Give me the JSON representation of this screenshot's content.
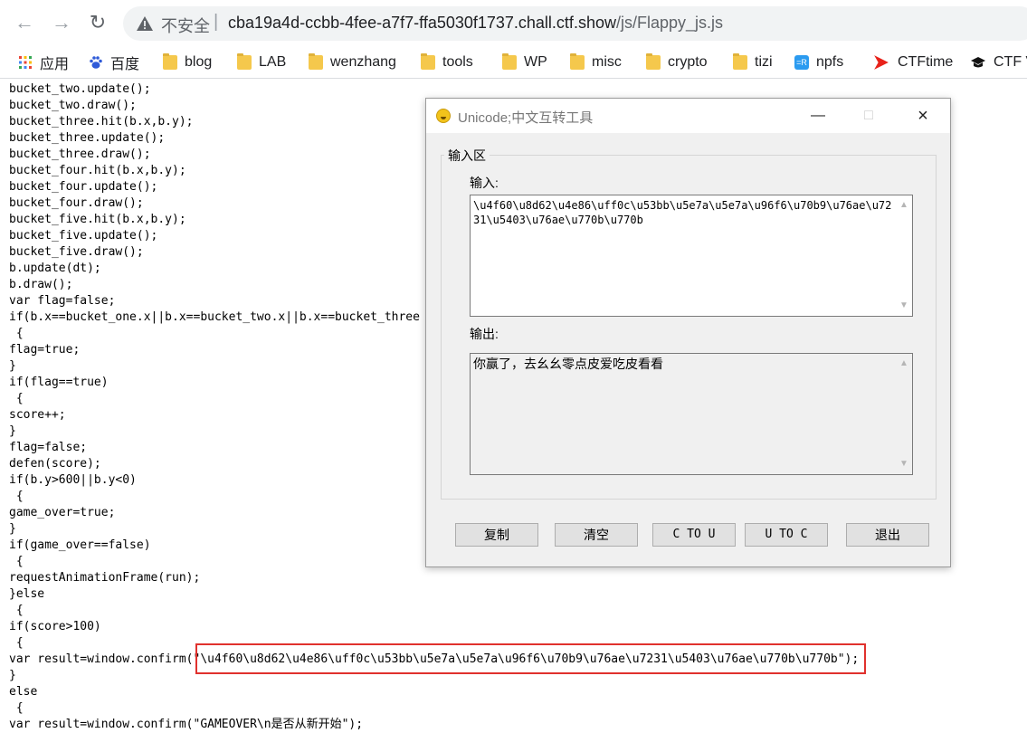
{
  "browser": {
    "url_warning": "不安全",
    "url_host": "cba19a4d-ccbb-4fee-a7f7-ffa5030f1737.chall.ctf.show",
    "url_path": "/js/Flappy_js.js",
    "icons": [
      "back-icon",
      "forward-icon",
      "reload-icon",
      "warning-icon"
    ]
  },
  "bookmarks": [
    {
      "label": "应用",
      "icon": "apps-grid-icon"
    },
    {
      "label": "百度",
      "icon": "baidu-paw-icon"
    },
    {
      "label": "blog",
      "icon": "folder-icon"
    },
    {
      "label": "LAB",
      "icon": "folder-icon"
    },
    {
      "label": "wenzhang",
      "icon": "folder-icon"
    },
    {
      "label": "tools",
      "icon": "folder-icon"
    },
    {
      "label": "WP",
      "icon": "folder-icon"
    },
    {
      "label": "misc",
      "icon": "folder-icon"
    },
    {
      "label": "crypto",
      "icon": "folder-icon"
    },
    {
      "label": "tizi",
      "icon": "folder-icon"
    },
    {
      "label": "npfs",
      "icon": "npfs-icon"
    },
    {
      "label": "CTFtime",
      "icon": "ctftime-icon"
    },
    {
      "label": "CTF V",
      "icon": "graduation-cap-icon"
    }
  ],
  "code_lines": [
    "bucket_two.update();",
    "bucket_two.draw();",
    "bucket_three.hit(b.x,b.y);",
    "bucket_three.update();",
    "bucket_three.draw();",
    "bucket_four.hit(b.x,b.y);",
    "bucket_four.update();",
    "bucket_four.draw();",
    "bucket_five.hit(b.x,b.y);",
    "bucket_five.update();",
    "bucket_five.draw();",
    "b.update(dt);",
    "b.draw();",
    "var flag=false;",
    "if(b.x==bucket_one.x||b.x==bucket_two.x||b.x==bucket_three",
    " {",
    "flag=true;",
    "}",
    "if(flag==true)",
    " {",
    "score++;",
    "}",
    "flag=false;",
    "defen(score);",
    "if(b.y>600||b.y<0)",
    " {",
    "game_over=true;",
    "}",
    "if(game_over==false)",
    " {",
    "requestAnimationFrame(run);",
    "}else",
    " {",
    "if(score>100)",
    " {",
    "var result=window.confirm(\"\\u4f60\\u8d62\\u4e86\\uff0c\\u53bb\\u5e7a\\u5e7a\\u96f6\\u70b9\\u76ae\\u7231\\u5403\\u76ae\\u770b\\u770b\");",
    "}",
    "else",
    " {",
    "var result=window.confirm(\"GAMEOVER\\n是否从新开始\");"
  ],
  "dialog": {
    "title": "Unicode;中文互转工具",
    "group_title": "输入区",
    "input_label": "输入:",
    "input_value": "\\u4f60\\u8d62\\u4e86\\uff0c\\u53bb\\u5e7a\\u5e7a\\u96f6\\u70b9\\u76ae\\u7231\\u5403\\u76ae\\u770b\\u770b",
    "output_label": "输出:",
    "output_value": "你赢了，去幺幺零点皮爱吃皮看看",
    "buttons": {
      "copy": "复制",
      "clear": "清空",
      "c_to_u": "C TO U",
      "u_to_c": "U TO C",
      "exit": "退出"
    }
  },
  "annotation_color": "#e0312d"
}
